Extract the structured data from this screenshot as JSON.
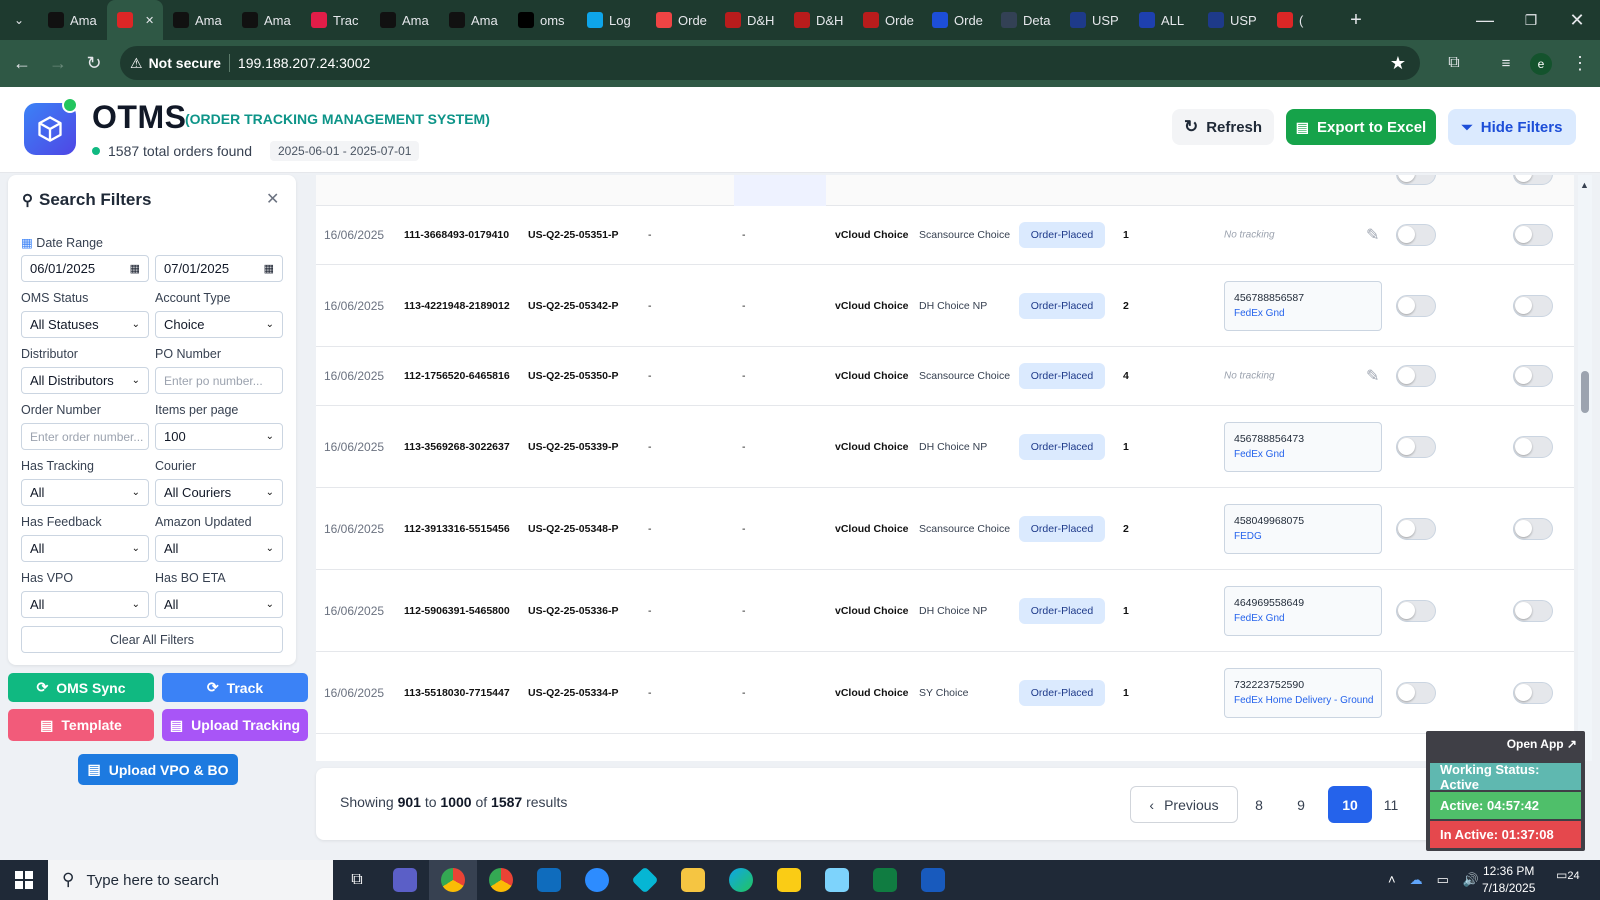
{
  "browser": {
    "tabs": [
      {
        "label": "Ama",
        "icon": "amazon-icon"
      },
      {
        "label": "",
        "icon": "app-icon",
        "active": true
      },
      {
        "label": "Ama",
        "icon": "amazon-icon"
      },
      {
        "label": "Ama",
        "icon": "amazon-icon"
      },
      {
        "label": "Trac",
        "icon": "tracking-icon"
      },
      {
        "label": "Ama",
        "icon": "amazon-icon"
      },
      {
        "label": "Ama",
        "icon": "amazon-icon"
      },
      {
        "label": "oms",
        "icon": "oms-icon"
      },
      {
        "label": "Log",
        "icon": "login-icon"
      },
      {
        "label": "Orde",
        "icon": "order-icon"
      },
      {
        "label": "D&H",
        "icon": "dh-icon"
      },
      {
        "label": "D&H",
        "icon": "dh-icon"
      },
      {
        "label": "Orde",
        "icon": "dh-icon"
      },
      {
        "label": "Orde",
        "icon": "ec-icon"
      },
      {
        "label": "Deta",
        "icon": "flag-icon"
      },
      {
        "label": "USP",
        "icon": "usps-icon"
      },
      {
        "label": "ALL",
        "icon": "17track-icon"
      },
      {
        "label": "USP",
        "icon": "usps-icon"
      },
      {
        "label": "(",
        "icon": "youtube-icon"
      }
    ],
    "security_label": "Not secure",
    "url": "199.188.207.24:3002",
    "profile_initial": "e"
  },
  "header": {
    "title": "OTMS",
    "subtitle": "(ORDER TRACKING MANAGEMENT SYSTEM)",
    "count_text": "1587 total orders found",
    "date_range": "2025-06-01 - 2025-07-01",
    "refresh_label": "Refresh",
    "export_label": "Export to Excel",
    "hide_filters_label": "Hide Filters"
  },
  "filters": {
    "title": "Search Filters",
    "date_range_label": "Date Range",
    "date_from": "06/01/2025",
    "date_to": "07/01/2025",
    "oms_status_label": "OMS Status",
    "oms_status_value": "All Statuses",
    "account_type_label": "Account Type",
    "account_type_value": "Choice",
    "distributor_label": "Distributor",
    "distributor_value": "All Distributors",
    "po_number_label": "PO Number",
    "po_number_placeholder": "Enter po number...",
    "order_number_label": "Order Number",
    "order_number_placeholder": "Enter order number...",
    "items_per_page_label": "Items per page",
    "items_per_page_value": "100",
    "has_tracking_label": "Has Tracking",
    "has_tracking_value": "All",
    "courier_label": "Courier",
    "courier_value": "All Couriers",
    "has_feedback_label": "Has Feedback",
    "has_feedback_value": "All",
    "amazon_updated_label": "Amazon Updated",
    "amazon_updated_value": "All",
    "has_vpo_label": "Has VPO",
    "has_vpo_value": "All",
    "has_bo_eta_label": "Has BO ETA",
    "has_bo_eta_value": "All",
    "clear_label": "Clear All Filters"
  },
  "actions": {
    "oms_sync": "OMS Sync",
    "track": "Track",
    "template": "Template",
    "upload_tracking": "Upload Tracking",
    "upload_vpo": "Upload VPO & BO"
  },
  "orders": [
    {
      "date": "16/06/2025",
      "order": "111-3668493-0179410",
      "po": "US-Q2-25-05351-P",
      "d1": "-",
      "d2": "-",
      "account": "vCloud Choice",
      "distributor": "Scansource Choice",
      "status": "Order-Placed",
      "qty": "1",
      "tracking": null,
      "carrier": null,
      "no_tracking": "No tracking"
    },
    {
      "date": "16/06/2025",
      "order": "113-4221948-2189012",
      "po": "US-Q2-25-05342-P",
      "d1": "-",
      "d2": "-",
      "account": "vCloud Choice",
      "distributor": "DH Choice NP",
      "status": "Order-Placed",
      "qty": "2",
      "tracking": "456788856587",
      "carrier": "FedEx Gnd",
      "no_tracking": null
    },
    {
      "date": "16/06/2025",
      "order": "112-1756520-6465816",
      "po": "US-Q2-25-05350-P",
      "d1": "-",
      "d2": "-",
      "account": "vCloud Choice",
      "distributor": "Scansource Choice",
      "status": "Order-Placed",
      "qty": "4",
      "tracking": null,
      "carrier": null,
      "no_tracking": "No tracking"
    },
    {
      "date": "16/06/2025",
      "order": "113-3569268-3022637",
      "po": "US-Q2-25-05339-P",
      "d1": "-",
      "d2": "-",
      "account": "vCloud Choice",
      "distributor": "DH Choice NP",
      "status": "Order-Placed",
      "qty": "1",
      "tracking": "456788856473",
      "carrier": "FedEx Gnd",
      "no_tracking": null
    },
    {
      "date": "16/06/2025",
      "order": "112-3913316-5515456",
      "po": "US-Q2-25-05348-P",
      "d1": "-",
      "d2": "-",
      "account": "vCloud Choice",
      "distributor": "Scansource Choice",
      "status": "Order-Placed",
      "qty": "2",
      "tracking": "458049968075",
      "carrier": "FEDG",
      "no_tracking": null
    },
    {
      "date": "16/06/2025",
      "order": "112-5906391-5465800",
      "po": "US-Q2-25-05336-P",
      "d1": "-",
      "d2": "-",
      "account": "vCloud Choice",
      "distributor": "DH Choice NP",
      "status": "Order-Placed",
      "qty": "1",
      "tracking": "464969558649",
      "carrier": "FedEx Gnd",
      "no_tracking": null
    },
    {
      "date": "16/06/2025",
      "order": "113-5518030-7715447",
      "po": "US-Q2-25-05334-P",
      "d1": "-",
      "d2": "-",
      "account": "vCloud Choice",
      "distributor": "SY Choice",
      "status": "Order-Placed",
      "qty": "1",
      "tracking": "732223752590",
      "carrier": "FedEx Home Delivery - Ground",
      "no_tracking": null
    }
  ],
  "pagination": {
    "showing_prefix": "Showing",
    "from": "901",
    "to_word": "to",
    "to": "1000",
    "of_word": "of",
    "total": "1587",
    "results_word": "results",
    "previous": "Previous",
    "pages": [
      "8",
      "9",
      "10",
      "11"
    ],
    "current": "10"
  },
  "status_widget": {
    "open_app": "Open App ↗",
    "working": "Working Status: Active",
    "active": "Active: 04:57:42",
    "inactive": "In Active: 01:37:08"
  },
  "taskbar": {
    "search_placeholder": "Type here to search",
    "time": "12:36 PM",
    "date": "7/18/2025",
    "notifications": "24"
  },
  "colors": {
    "primary": "#2563eb",
    "success": "#16a34a",
    "accent_teal": "#0d9488",
    "purple": "#a855f7",
    "pink": "#f25b7a",
    "chrome_bg": "#1e3a2f"
  }
}
